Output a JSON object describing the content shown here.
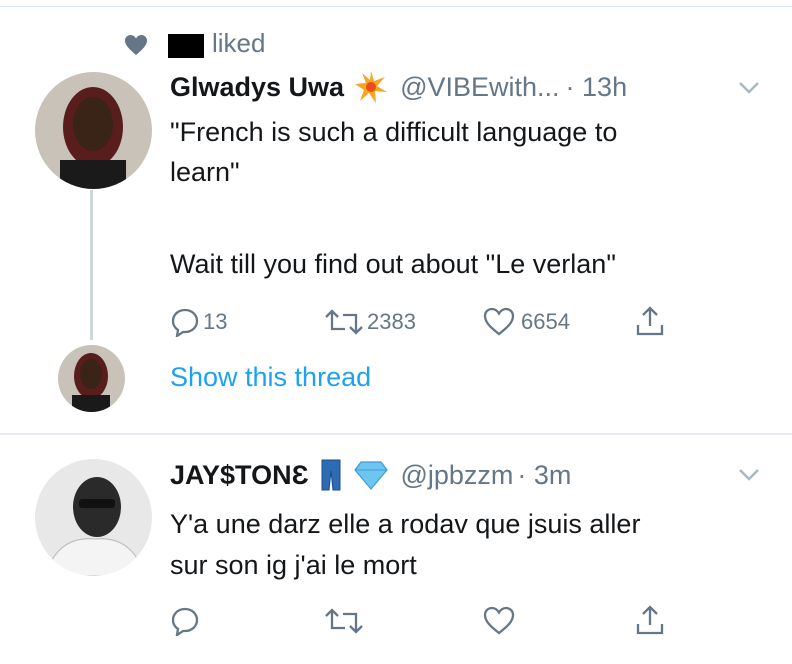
{
  "social_context": {
    "text": "liked"
  },
  "tweet1": {
    "name": "Glwadys Uwa",
    "handle": "@VIBEwith...",
    "time": "· 13h",
    "text_line1": "\"French is such a difficult language to",
    "text_line2": "learn\"",
    "text_line3": "Wait till you find out about \"Le verlan\"",
    "replies": "13",
    "retweets": "2383",
    "likes": "6654"
  },
  "thread": {
    "show_label": "Show this thread"
  },
  "tweet2": {
    "name": "JAY$TONƐ",
    "handle": "@jpbzzm",
    "time": "· 3m",
    "text_line1": "Y'a une darz elle a rodav que jsuis aller",
    "text_line2": "sur son ig j'ai le mort"
  },
  "colors": {
    "link": "#1da1f2",
    "muted": "#657786",
    "text": "#14171a"
  }
}
